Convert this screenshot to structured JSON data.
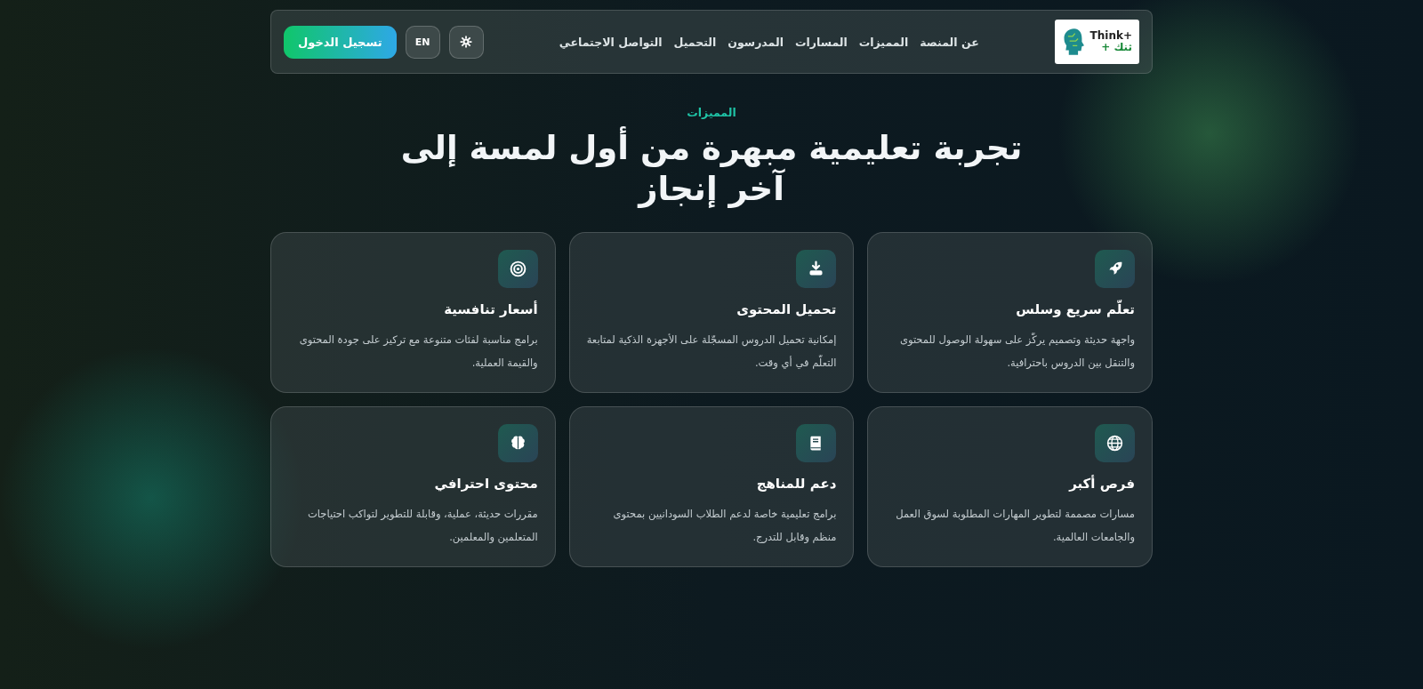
{
  "header": {
    "logo": {
      "latin": "Think+",
      "arabic": "ثنك +"
    },
    "nav": [
      "عن المنصة",
      "المميزات",
      "المسارات",
      "المدرسون",
      "التحميل",
      "التواصل الاجتماعي"
    ],
    "language_button": "EN",
    "login_button": "تسجيل الدخول"
  },
  "section": {
    "eyebrow": "المميزات",
    "heading": "تجربة تعليمية مبهرة من أول لمسة إلى آخر إنجاز"
  },
  "features": [
    {
      "title": "تعلّم سريع وسلس",
      "text": "واجهة حديثة وتصميم يركّز على سهولة الوصول للمحتوى والتنقل بين الدروس باحترافية."
    },
    {
      "title": "تحميل المحتوى",
      "text": "إمكانية تحميل الدروس المسجّلة على الأجهزة الذكية لمتابعة التعلّم في أي وقت."
    },
    {
      "title": "أسعار تنافسية",
      "text": "برامج مناسبة لفئات متنوعة مع تركيز على جودة المحتوى والقيمة العملية."
    },
    {
      "title": "فرص أكبر",
      "text": "مسارات مصممة لتطوير المهارات المطلوبة لسوق العمل والجامعات العالمية."
    },
    {
      "title": "دعم للمناهج",
      "text": "برامج تعليمية خاصة لدعم الطلاب السودانيين بمحتوى منظم وقابل للتدرج."
    },
    {
      "title": "محتوى احترافي",
      "text": "مقررات حديثة، عملية، وقابلة للتطوير لتواكب احتياجات المتعلمين والمعلمين."
    }
  ]
}
